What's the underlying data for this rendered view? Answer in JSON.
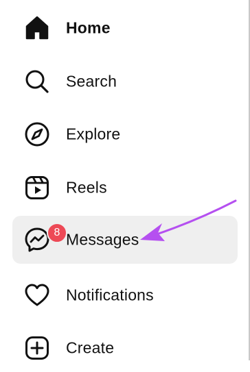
{
  "nav": {
    "items": [
      {
        "label": "Home",
        "icon": "home-icon",
        "active": false
      },
      {
        "label": "Search",
        "icon": "search-icon",
        "active": false
      },
      {
        "label": "Explore",
        "icon": "compass-icon",
        "active": false
      },
      {
        "label": "Reels",
        "icon": "reels-icon",
        "active": false
      },
      {
        "label": "Messages",
        "icon": "messenger-icon",
        "active": true,
        "badge": "8"
      },
      {
        "label": "Notifications",
        "icon": "heart-icon",
        "active": false
      },
      {
        "label": "Create",
        "icon": "plus-square-icon",
        "active": false
      }
    ]
  },
  "colors": {
    "badge": "#ed4956",
    "annotation_arrow": "#b550f0",
    "active_bg": "#efefef"
  }
}
